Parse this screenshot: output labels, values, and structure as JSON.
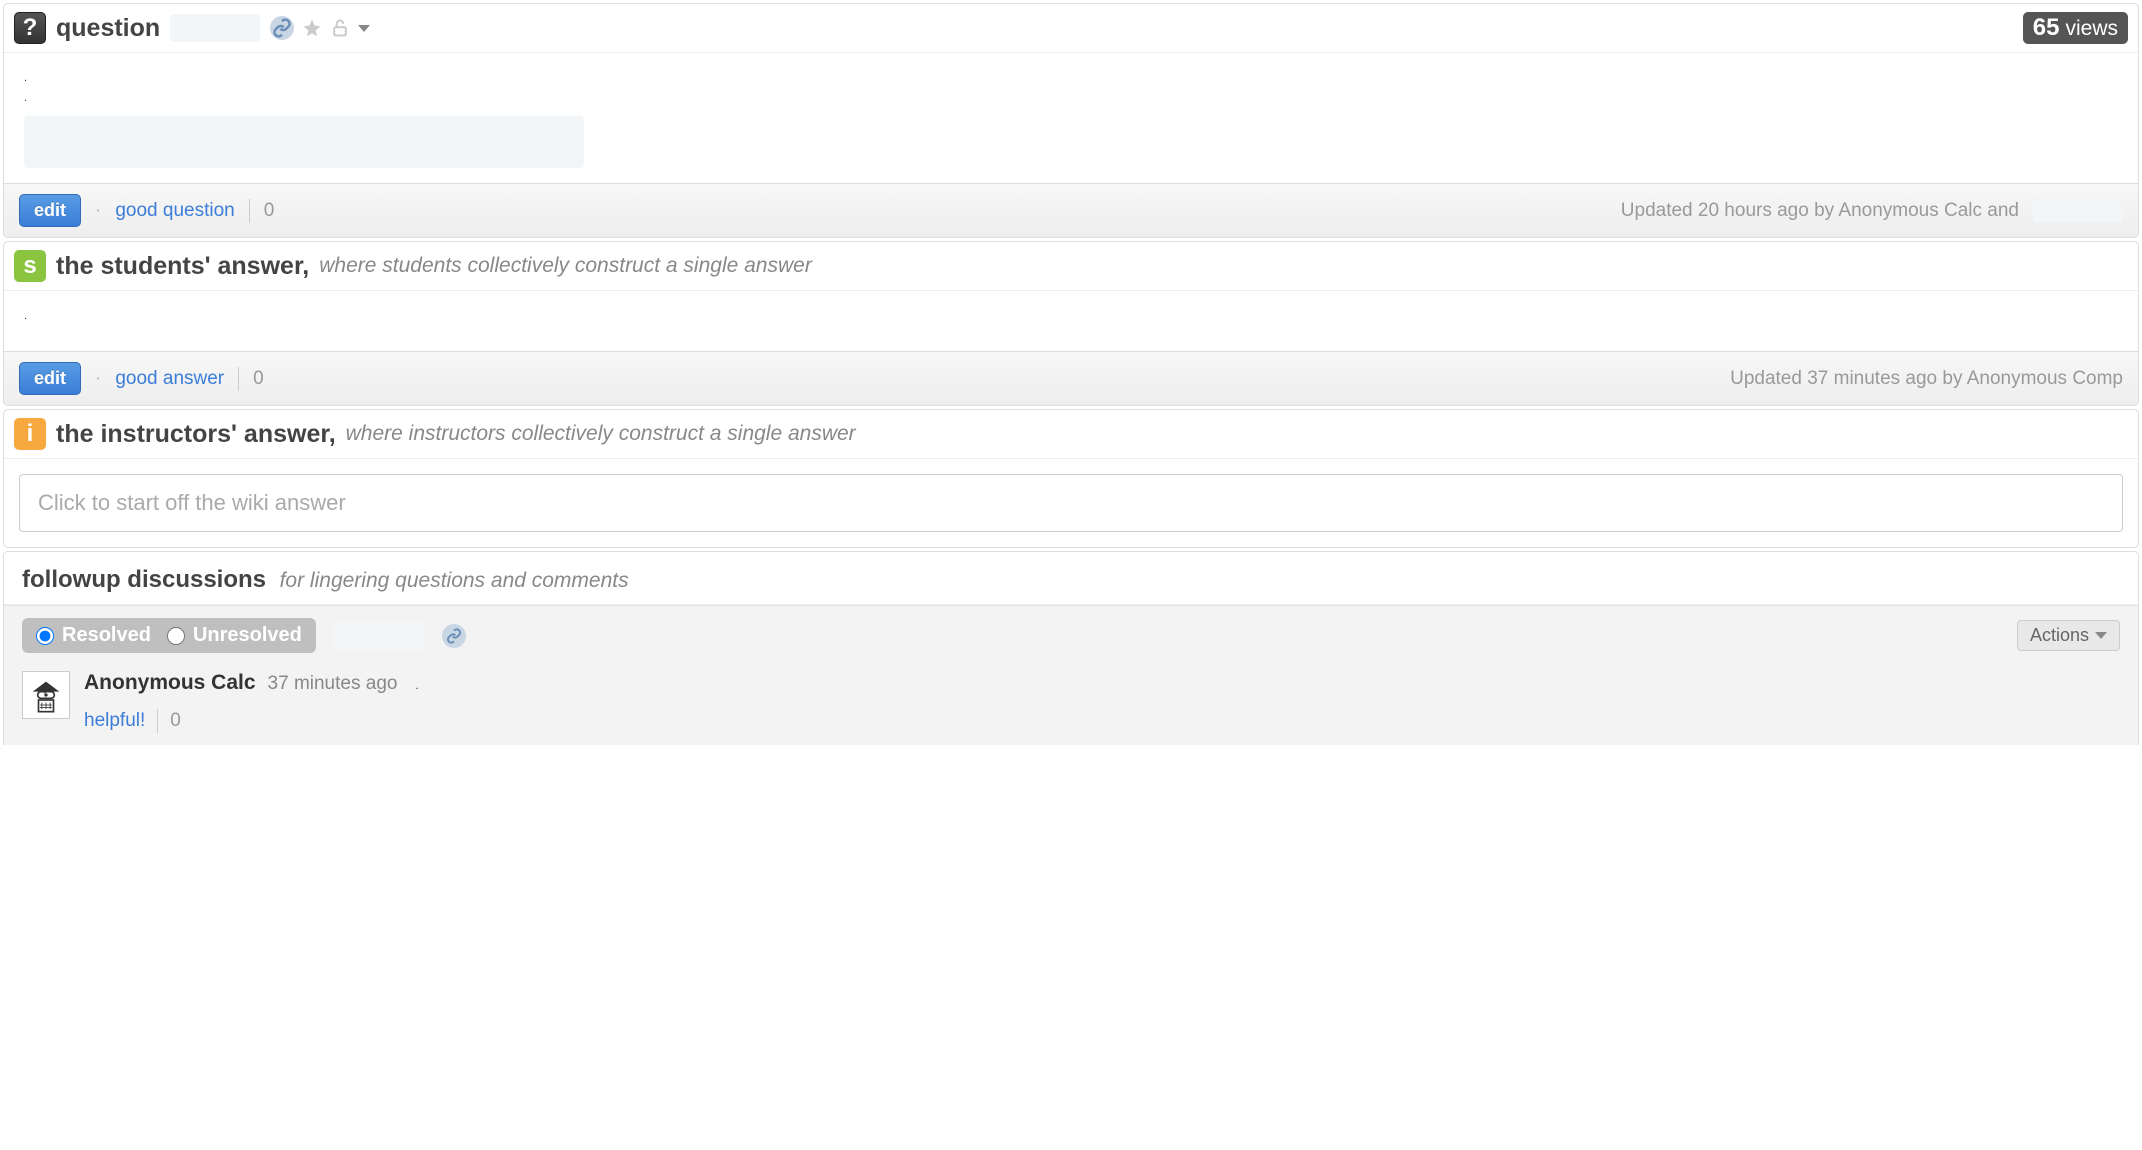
{
  "question": {
    "label": "question",
    "views_count": "65",
    "views_label": "views",
    "edit": "edit",
    "good_question": "good question",
    "good_question_count": "0",
    "updated": "Updated 20 hours ago by Anonymous Calc and"
  },
  "students_answer": {
    "title": "the students' answer,",
    "subtitle": "where students collectively construct a single answer",
    "edit": "edit",
    "good_answer": "good answer",
    "good_answer_count": "0",
    "updated": "Updated 37 minutes ago by Anonymous Comp"
  },
  "instructors_answer": {
    "title": "the instructors' answer,",
    "subtitle": "where instructors collectively construct a single answer",
    "wiki_placeholder": "Click to start off the wiki answer"
  },
  "followups": {
    "title": "followup discussions",
    "subtitle": "for lingering questions and comments",
    "resolved": "Resolved",
    "unresolved": "Unresolved",
    "actions": "Actions",
    "comment": {
      "author": "Anonymous Calc",
      "time": "37 minutes ago",
      "body": ".",
      "helpful": "helpful!",
      "helpful_count": "0"
    }
  }
}
